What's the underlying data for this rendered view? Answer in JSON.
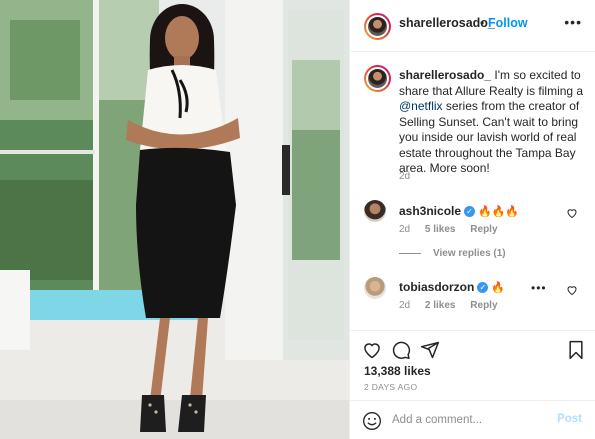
{
  "post": {
    "username": "sharellerosado_",
    "dot": "•",
    "follow_label": "Follow",
    "more_label": "•••",
    "caption_username": "sharellerosado_",
    "caption_part1": " I'm so excited to share that Allure Realty is filming a ",
    "caption_link": "@netflix",
    "caption_part2": " series from the creator of Selling Sunset. Can't wait to bring you inside our lavish world of real estate throughout the Tampa Bay area. More soon!",
    "caption_time": "2d"
  },
  "comments": [
    {
      "username": "ash3nicole",
      "verified": "✓",
      "emoji": "🔥🔥🔥",
      "time": "2d",
      "likes": "5 likes",
      "reply": "Reply",
      "view_replies": "View replies (1)"
    },
    {
      "username": "tobiasdorzon",
      "verified": "✓",
      "emoji": "🔥",
      "time": "2d",
      "likes": "2 likes",
      "reply": "Reply",
      "more": "•••"
    }
  ],
  "stats": {
    "likes": "13,388 likes",
    "posted": "2 DAYS AGO"
  },
  "composer": {
    "placeholder": "Add a comment...",
    "post_label": "Post"
  },
  "icons": {
    "like": "heart-icon",
    "comment": "comment-icon",
    "share": "share-icon",
    "save": "bookmark-icon",
    "emoji": "smiley-icon"
  }
}
